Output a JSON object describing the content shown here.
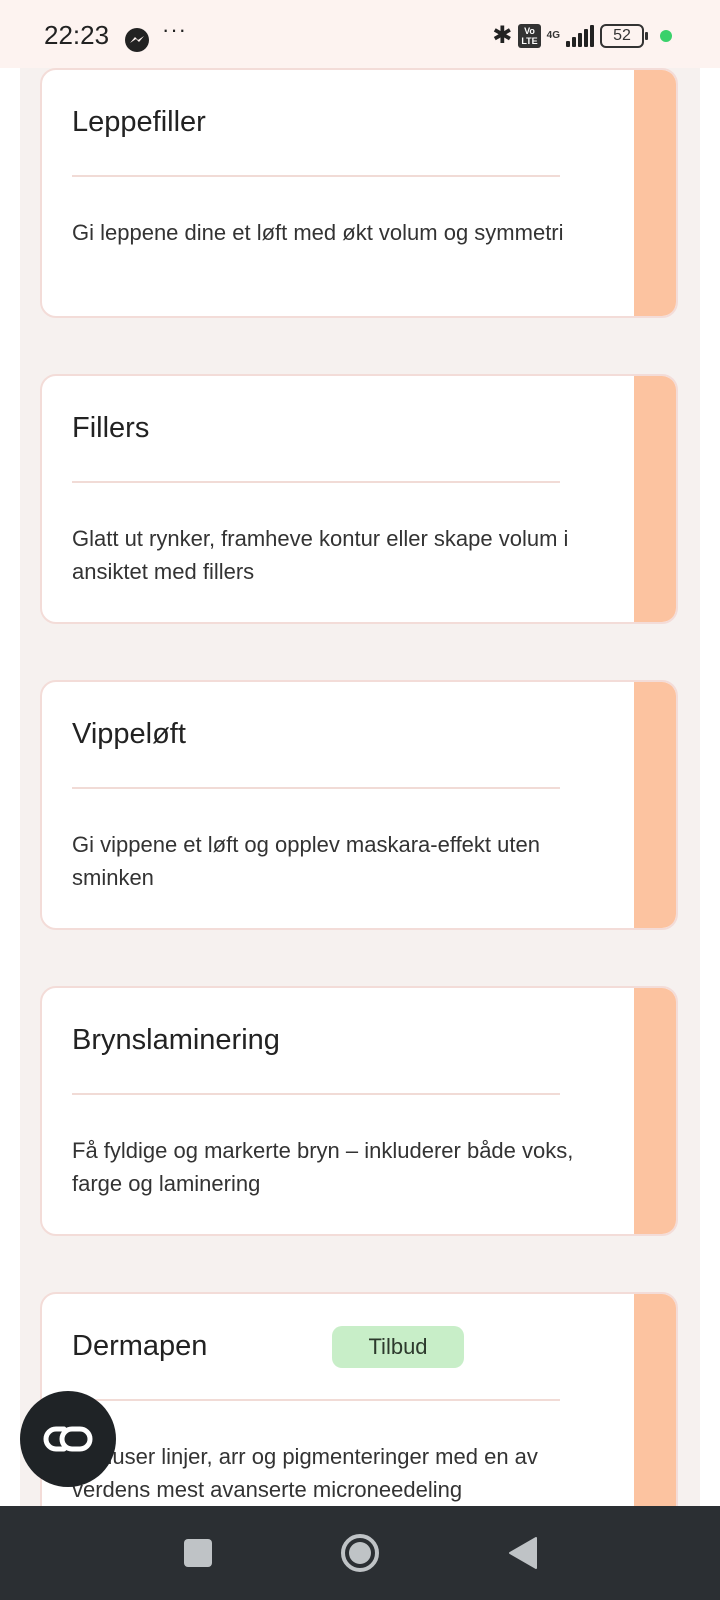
{
  "status_bar": {
    "time": "22:23",
    "more": "···",
    "volte": "Vo\nLTE",
    "network": "4G",
    "battery": "52"
  },
  "cards": [
    {
      "title": "Leppefiller",
      "description": "Gi leppene dine et løft med økt volum og symmetri"
    },
    {
      "title": "Fillers",
      "description": "Glatt ut rynker, framheve kontur eller skape volum i ansiktet med fillers"
    },
    {
      "title": "Vippeløft",
      "description": "Gi vippene et løft og opplev maskara-effekt uten sminken"
    },
    {
      "title": "Brynslaminering",
      "description": "Få fyldige og markerte bryn – inkluderer både voks, farge og laminering"
    },
    {
      "title": "Dermapen",
      "badge": "Tilbud",
      "description": "Reduser linjer, arr og pigmenteringer med en av verdens mest avanserte microneedeling"
    }
  ],
  "colors": {
    "accent_stripe": "#fcc3a0",
    "badge_bg": "#c8eec8",
    "page_bg": "#f6f1ef",
    "nav_bg": "#2b2f33"
  },
  "icons": {
    "fab": "link-icon",
    "nav_recents": "square-icon",
    "nav_home": "circle-icon",
    "nav_back": "triangle-back-icon"
  }
}
